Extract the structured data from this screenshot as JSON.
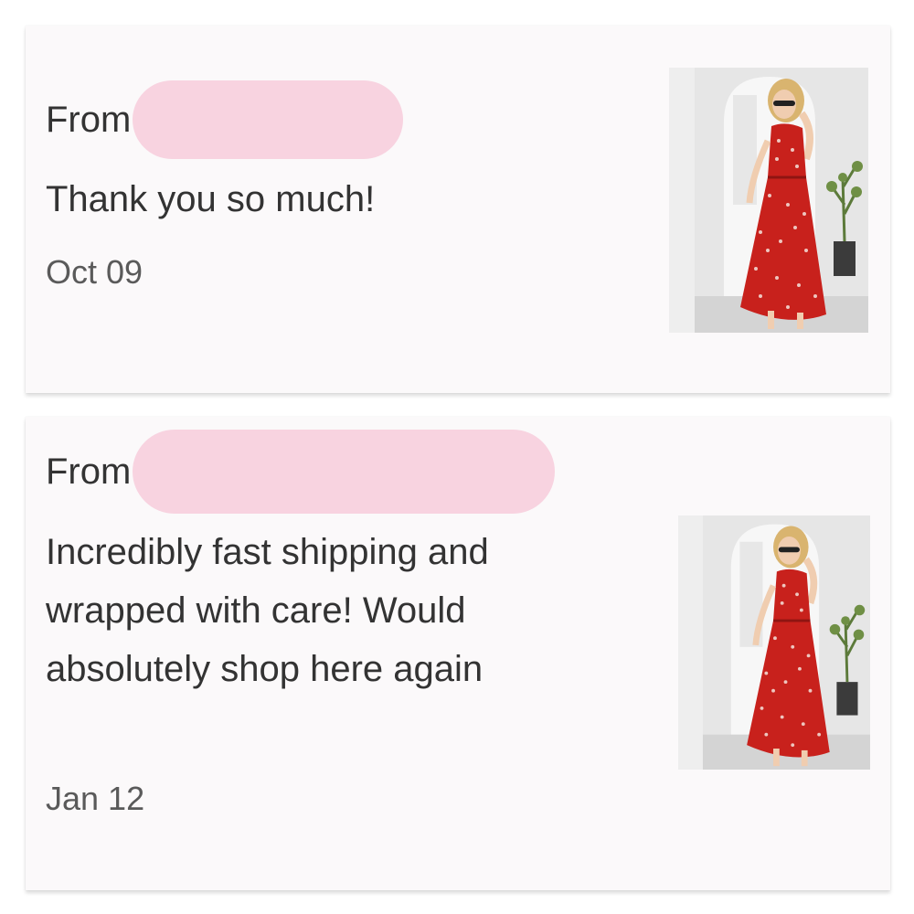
{
  "reviews": [
    {
      "from_label": "From",
      "message": "Thank you so much!",
      "date": "Oct 09",
      "image": "red-floral-dress-photo"
    },
    {
      "from_label": "From",
      "message": "Incredibly fast shipping and wrapped with care! Would absolutely shop here again",
      "date": "Jan 12",
      "image": "red-floral-dress-photo"
    }
  ],
  "colors": {
    "card_background": "#fbf9fa",
    "redaction_pink": "#f8d3e0",
    "text_primary": "#333333",
    "text_date": "#5a5a5a",
    "dress_red": "#c8211c"
  }
}
